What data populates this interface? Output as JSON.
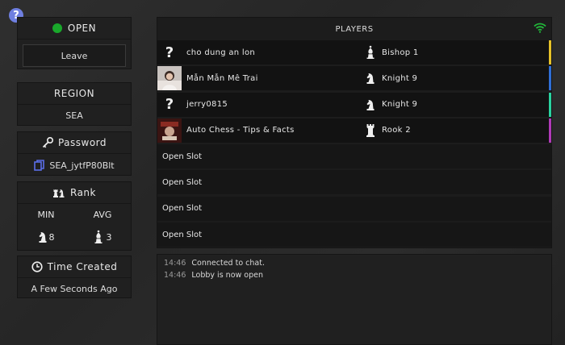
{
  "help": {
    "label": "?"
  },
  "status": {
    "label": "OPEN",
    "color": "#19a82b"
  },
  "leave": {
    "label": "Leave"
  },
  "region": {
    "label": "REGION",
    "value": "SEA"
  },
  "password": {
    "label": "Password",
    "value": "SEA_jytfP80Blt"
  },
  "rank": {
    "label": "Rank",
    "min_label": "MIN",
    "avg_label": "AVG",
    "min_value": "8",
    "avg_value": "3"
  },
  "time_created": {
    "label": "Time Created",
    "value": "A Few Seconds Ago"
  },
  "players": {
    "title": "PLAYERS",
    "rows": [
      {
        "name": "cho dung an lon",
        "rank": "Bishop 1",
        "avatar": "?",
        "piece": "bishop",
        "bar": "#e6c229"
      },
      {
        "name": "Mẫn Mẫn Mê Trai",
        "rank": "Knight 9",
        "avatar": "",
        "piece": "knight",
        "bar": "#2f6fd6"
      },
      {
        "name": "jerry0815",
        "rank": "Knight 9",
        "avatar": "?",
        "piece": "knight",
        "bar": "#2ad3a0"
      },
      {
        "name": "Auto Chess - Tips & Facts",
        "rank": "Rook 2",
        "avatar": "",
        "piece": "rook",
        "bar": "#b03ab8"
      }
    ],
    "open_slots": [
      "Open Slot",
      "Open Slot",
      "Open Slot",
      "Open Slot"
    ]
  },
  "chat": {
    "messages": [
      {
        "time": "14:46",
        "text": "Connected to chat."
      },
      {
        "time": "14:46",
        "text": "Lobby is now open"
      }
    ]
  }
}
